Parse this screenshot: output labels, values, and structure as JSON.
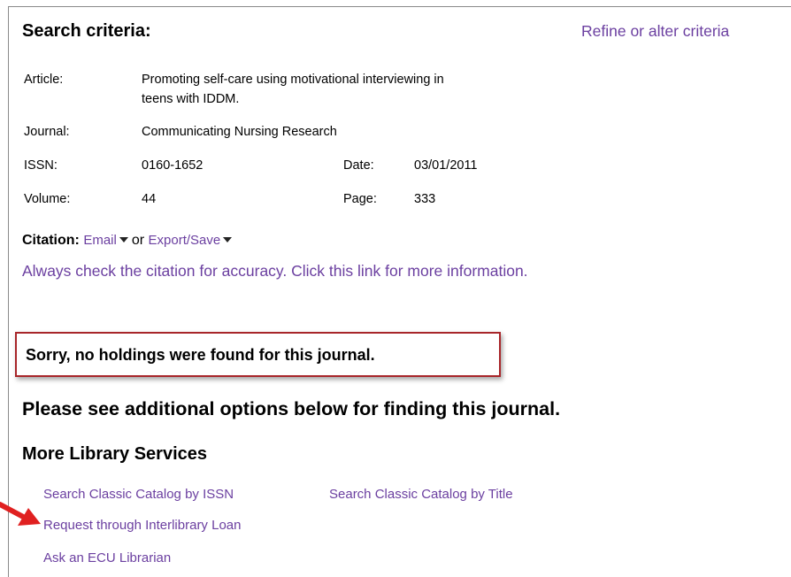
{
  "header": {
    "title": "Search criteria:",
    "refine_link": "Refine or alter criteria"
  },
  "criteria": {
    "article_label": "Article:",
    "article_line1": "Promoting self-care using motivational interviewing in",
    "article_line2": "teens with IDDM.",
    "journal_label": "Journal:",
    "journal_value": "Communicating Nursing Research",
    "issn_label": "ISSN:",
    "issn_value": "0160-1652",
    "date_label": "Date:",
    "date_value": "03/01/2011",
    "volume_label": "Volume:",
    "volume_value": "44",
    "page_label": "Page:",
    "page_value": "333"
  },
  "citation": {
    "label": "Citation:",
    "email_link": "Email",
    "or_text": "or",
    "export_link": "Export/Save",
    "accuracy_link": "Always check the citation for accuracy. Click this link for more information."
  },
  "notice": {
    "sorry": "Sorry, no holdings were found for this journal."
  },
  "additional": {
    "text": "Please see additional options below for finding this journal."
  },
  "services": {
    "title": "More Library Services",
    "search_issn": "Search Classic Catalog by ISSN",
    "search_title": "Search Classic Catalog by Title",
    "ill": "Request through Interlibrary Loan",
    "ask": "Ask an ECU Librarian"
  },
  "colors": {
    "link": "#6b3fa0",
    "highlight_border": "#a8262a",
    "arrow": "#e02020"
  }
}
